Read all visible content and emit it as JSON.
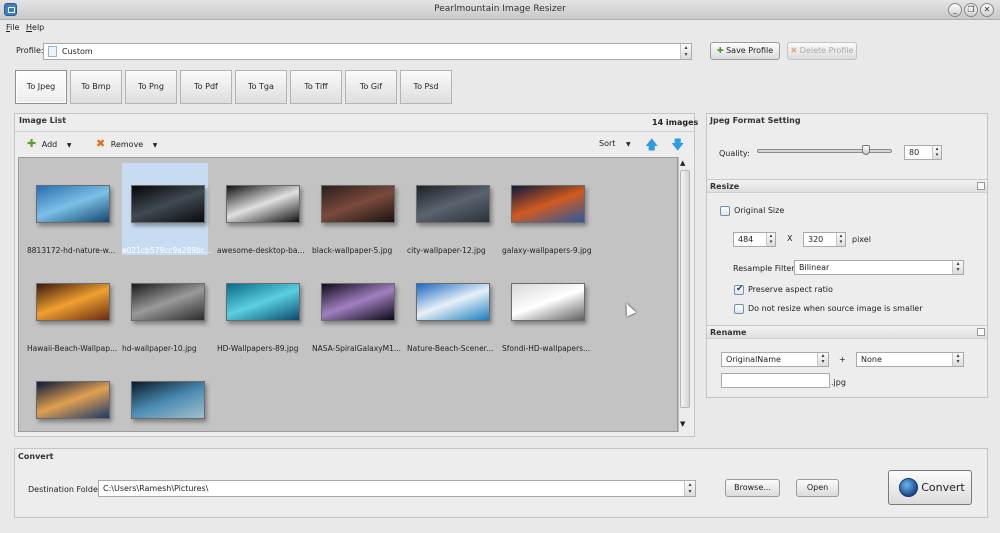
{
  "window": {
    "title": "Pearlmountain Image Resizer",
    "controls": [
      "_",
      "❐",
      "✕"
    ]
  },
  "menu": [
    "File",
    "Help"
  ],
  "profile": {
    "label": "Profile:",
    "value": "Custom",
    "save_label": "Save Profile",
    "delete_label": "Delete Profile"
  },
  "formats": [
    "To Jpeg",
    "To Bmp",
    "To Png",
    "To Pdf",
    "To Tga",
    "To Tiff",
    "To Gif",
    "To Psd"
  ],
  "image_list": {
    "title": "Image List",
    "count": "14 images",
    "add_label": "Add",
    "remove_label": "Remove",
    "sort_label": "Sort",
    "items": [
      {
        "name": "8813172-hd-nature-w...",
        "colors": [
          "#2a6fb0",
          "#7cc0e8",
          "#16466e"
        ]
      },
      {
        "name": "e021cb579cc9a289bc...",
        "colors": [
          "#050505",
          "#404a52",
          "#0a0a0a"
        ]
      },
      {
        "name": "awesome-desktop-ba...",
        "colors": [
          "#111111",
          "#e0e0e0",
          "#111111"
        ]
      },
      {
        "name": "black-wallpaper-5.jpg",
        "colors": [
          "#2b1f1d",
          "#7a4a3c",
          "#1b1412"
        ]
      },
      {
        "name": "city-wallpaper-12.jpg",
        "colors": [
          "#1d2228",
          "#5a6470",
          "#2a3038"
        ]
      },
      {
        "name": "galaxy-wallpapers-9.jpg",
        "colors": [
          "#0c1a3a",
          "#d05a20",
          "#2a5aa0"
        ]
      },
      {
        "name": "Hawaii-Beach-Wallpap...",
        "colors": [
          "#3a1a0c",
          "#f0a030",
          "#6a2a10"
        ]
      },
      {
        "name": "hd-wallpaper-10.jpg",
        "colors": [
          "#1a1a1a",
          "#9a9a9a",
          "#2a2a2a"
        ]
      },
      {
        "name": "HD-Wallpapers-89.jpg",
        "colors": [
          "#0a6a8a",
          "#5ad0e0",
          "#0a4a6a"
        ]
      },
      {
        "name": "NASA-SpiralGalaxyM1...",
        "colors": [
          "#120a1a",
          "#a080c0",
          "#0a0814"
        ]
      },
      {
        "name": "Nature-Beach-Scener...",
        "colors": [
          "#1a6ac0",
          "#e8f0f8",
          "#1a80c0"
        ]
      },
      {
        "name": "Sfondi-HD-wallpapers...",
        "colors": [
          "#d8d8d8",
          "#ffffff",
          "#606060"
        ]
      },
      {
        "name": "",
        "colors": [
          "#0a1a3a",
          "#e0a050",
          "#1a3a6a"
        ]
      },
      {
        "name": "",
        "colors": [
          "#0a1a2a",
          "#4a8ab0",
          "#a0c0d0"
        ]
      }
    ]
  },
  "jpeg": {
    "title": "Jpeg Format Setting",
    "quality_label": "Quality:",
    "quality_value": "80",
    "quality_fraction": 0.8
  },
  "resize": {
    "title": "Resize",
    "original_size_label": "Original Size",
    "original_size_checked": false,
    "width": "484",
    "x_label": "X",
    "height": "320",
    "unit": "pixel",
    "filter_label": "Resample Filter:",
    "filter_value": "Bilinear",
    "aspect_label": "Preserve aspect ratio",
    "aspect_checked": true,
    "noresize_label": "Do not resize when source image is smaller",
    "noresize_checked": false
  },
  "rename": {
    "title": "Rename",
    "pattern": "OriginalName",
    "plus": "+",
    "suffix": "None",
    "text": "",
    "ext": ".jpg"
  },
  "convert": {
    "title": "Convert",
    "dest_label": "Destination Folder:",
    "dest_value": "C:\\Users\\Ramesh\\Pictures\\",
    "browse_label": "Browse...",
    "open_label": "Open",
    "convert_label": "Convert"
  }
}
